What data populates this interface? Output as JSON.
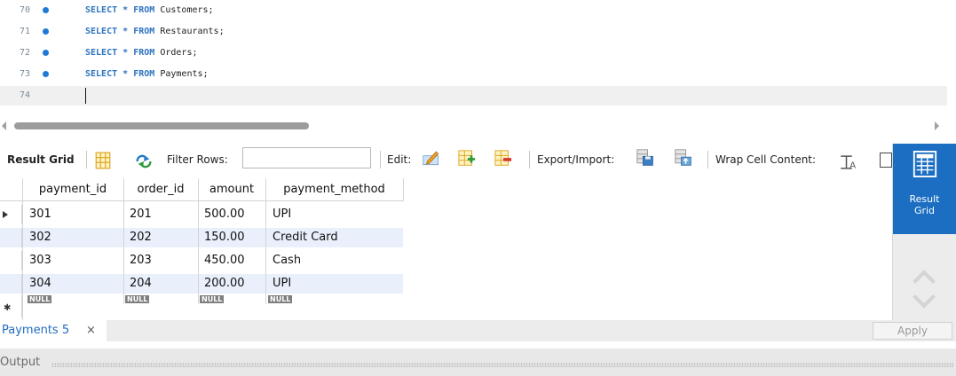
{
  "editor": {
    "lines": [
      {
        "number": "70",
        "keyword1": "SELECT",
        "star": "*",
        "keyword2": "FROM",
        "table": "Customers;"
      },
      {
        "number": "71",
        "keyword1": "SELECT",
        "star": "*",
        "keyword2": "FROM",
        "table": "Restaurants;"
      },
      {
        "number": "72",
        "keyword1": "SELECT",
        "star": "*",
        "keyword2": "FROM",
        "table": "Orders;"
      },
      {
        "number": "73",
        "keyword1": "SELECT",
        "star": "*",
        "keyword2": "FROM",
        "table": "Payments;"
      }
    ],
    "current_line_number": "74"
  },
  "toolbar": {
    "result_grid_label": "Result Grid",
    "filter_rows_label": "Filter Rows:",
    "filter_value": "",
    "edit_label": "Edit:",
    "export_import_label": "Export/Import:",
    "wrap_cell_label": "Wrap Cell Content:"
  },
  "side_panel": {
    "result_grid_line1": "Result",
    "result_grid_line2": "Grid",
    "accent_color": "#1b6ec2"
  },
  "grid": {
    "columns": [
      "payment_id",
      "order_id",
      "amount",
      "payment_method"
    ],
    "rows": [
      [
        "301",
        "201",
        "500.00",
        "UPI"
      ],
      [
        "302",
        "202",
        "150.00",
        "Credit Card"
      ],
      [
        "303",
        "203",
        "450.00",
        "Cash"
      ],
      [
        "304",
        "204",
        "200.00",
        "UPI"
      ]
    ],
    "null_label": "NULL",
    "alt_row_color": "#e9f0fb"
  },
  "tabs": {
    "active_tab": "Payments 5",
    "close_symbol": "×",
    "apply_label": "Apply"
  },
  "output": {
    "label": "Output"
  }
}
